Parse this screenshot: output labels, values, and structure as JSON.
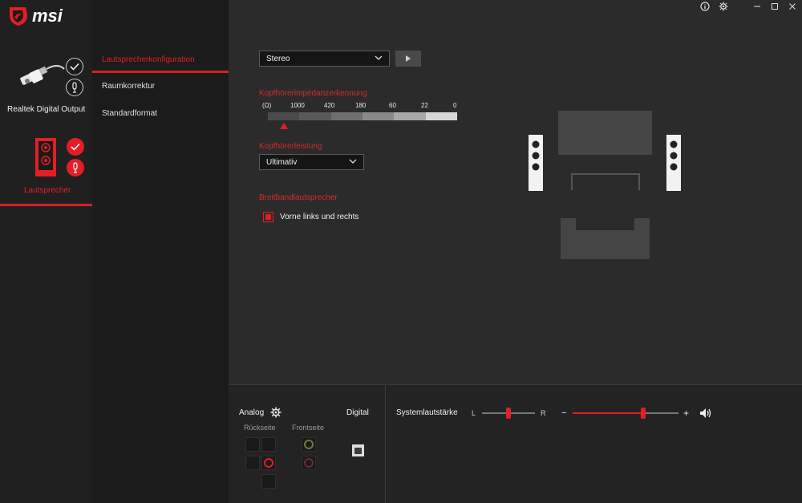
{
  "app": {
    "logo_text": "msi",
    "title_bar_icons": [
      "info-icon",
      "gear-icon",
      "minimize-icon",
      "maximize-icon",
      "close-icon"
    ]
  },
  "devices": [
    {
      "label": "Realtek Digital Output",
      "icon": "digital-output-plug-icon",
      "selected": false
    },
    {
      "label": "Lautsprecher",
      "icon": "speaker-icon",
      "selected": true
    }
  ],
  "menu": {
    "items": [
      {
        "label": "Lautsprecherkonfiguration",
        "active": true
      },
      {
        "label": "Raumkorrektur",
        "active": false
      },
      {
        "label": "Standardformat",
        "active": false
      }
    ]
  },
  "speaker_config": {
    "selected": "Stereo",
    "play_icon": "play-icon"
  },
  "impedance": {
    "label": "Kopfhörerimpedanzerkennung",
    "unit": "(Ω)",
    "ticks": [
      "1000",
      "420",
      "180",
      "60",
      "22",
      "0"
    ],
    "segment_colors": [
      "#4a4a4a",
      "#595959",
      "#6f6f6f",
      "#8a8a8a",
      "#a8a8a8",
      "#d6d6d6"
    ],
    "marker_segment": 0
  },
  "headphone_power": {
    "label": "Kopfhörerleistung",
    "selected": "Ultimativ"
  },
  "fullrange": {
    "label": "Breitbandlautsprecher",
    "checkbox_label": "Vorne links und rechts",
    "checked": true
  },
  "bottom": {
    "analog_label": "Analog",
    "digital_label": "Digital",
    "rear_label": "Rückseite",
    "front_label": "Frontseite",
    "system_volume_label": "Systemlautstärke",
    "balance_left": "L",
    "balance_right": "R",
    "balance_value": 0.5,
    "volume_minus": "−",
    "volume_plus": "+",
    "volume_value": 0.67
  },
  "colors": {
    "accent": "#e31e24",
    "background": "#2b2b2b",
    "menu_bg": "#1b1b1b",
    "device_bg": "#202020"
  }
}
